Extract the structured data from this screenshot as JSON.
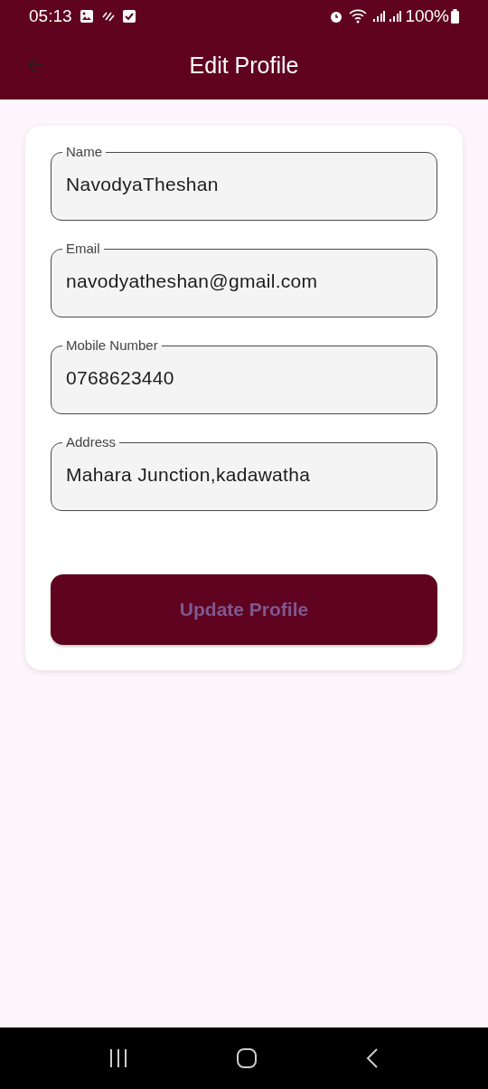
{
  "status_bar": {
    "time": "05:13",
    "battery": "100%"
  },
  "app_bar": {
    "title": "Edit Profile"
  },
  "form": {
    "fields": [
      {
        "label": "Name",
        "value": "NavodyaTheshan"
      },
      {
        "label": "Email",
        "value": "navodyatheshan@gmail.com"
      },
      {
        "label": "Mobile Number",
        "value": "0768623440"
      },
      {
        "label": "Address",
        "value": "Mahara Junction,kadawatha"
      }
    ],
    "submit_button": {
      "label": "Update Profile"
    }
  }
}
